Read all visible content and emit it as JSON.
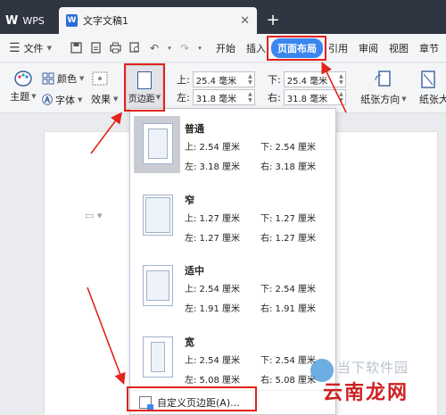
{
  "titlebar": {
    "app_tab": "WPS",
    "app_logo": "W",
    "doc_tab": "文字文稿1",
    "doc_logo": "W",
    "close": "✕",
    "add": "+"
  },
  "menubar": {
    "file": "文件",
    "items": [
      "开始",
      "插入",
      "页面布局",
      "引用",
      "审阅",
      "视图",
      "章节"
    ],
    "active": "页面布局"
  },
  "ribbon": {
    "theme": "主题",
    "colors": "颜色",
    "fonts": "字体",
    "effects": "效果",
    "margins": "页边距",
    "orientation": "纸张方向",
    "size": "纸张大小",
    "top_label": "上:",
    "top_value": "25.4 毫米",
    "bottom_label": "下:",
    "bottom_value": "25.4 毫米",
    "left_label": "左:",
    "left_value": "31.8 毫米",
    "right_label": "右:",
    "right_value": "31.8 毫米"
  },
  "dropdown": {
    "presets": [
      {
        "name": "普通",
        "top": "上: 2.54 厘米",
        "bottom": "下: 2.54 厘米",
        "left": "左: 3.18 厘米",
        "right": "右: 3.18 厘米"
      },
      {
        "name": "窄",
        "top": "上: 1.27 厘米",
        "bottom": "下: 1.27 厘米",
        "left": "左: 1.27 厘米",
        "right": "右: 1.27 厘米"
      },
      {
        "name": "适中",
        "top": "上: 2.54 厘米",
        "bottom": "下: 2.54 厘米",
        "left": "左: 1.91 厘米",
        "right": "右: 1.91 厘米"
      },
      {
        "name": "宽",
        "top": "上: 2.54 厘米",
        "bottom": "下: 2.54 厘米",
        "left": "左: 5.08 厘米",
        "right": "右: 5.08 厘米"
      }
    ],
    "custom": "自定义页边距(A)..."
  },
  "watermark": {
    "top": "当下软件园",
    "bottom": "云南龙网"
  },
  "colors": {
    "accent": "#3b86f0",
    "annotation": "#e2231a",
    "titlebar": "#2f3541"
  }
}
